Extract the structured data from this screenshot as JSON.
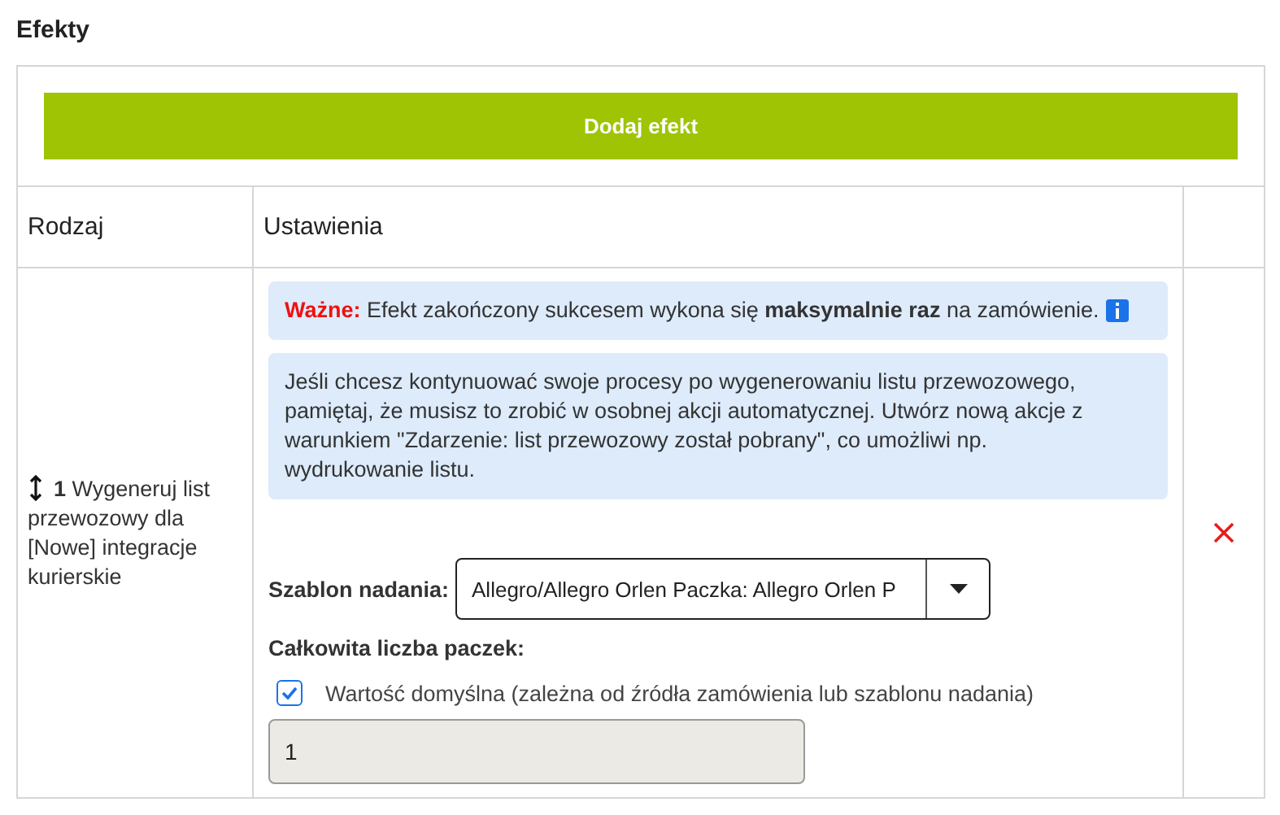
{
  "section_title": "Efekty",
  "add_button": "Dodaj efekt",
  "table": {
    "columns": [
      "Rodzaj",
      "Ustawienia"
    ],
    "rows": [
      {
        "number": "1",
        "name": "Wygeneruj list przewozowy dla [Nowe] integracje kurierskie",
        "notice": {
          "label": "Ważne:",
          "text": "Efekt zakończony sukcesem wykona się **maksymalnie raz** na zamówienie."
        },
        "info": "Jeśli chcesz kontynuować swoje procesy po wygenerowaniu listu przewozowego, pamiętaj, że musisz to zrobić w osobnej akcji automatycznej. Utwórz nową akcje z warunkiem \"Zdarzenie: list przewozowy został pobrany\", co umożliwi np. wydrukowanie listu.",
        "template": {
          "label": "Szablon nadania:",
          "value": "Allegro/Allegro Orlen Paczka: Allegro Orlen P"
        },
        "packages": {
          "label": "Całkowita liczba paczek:",
          "default_checkbox": {
            "label": "Wartość domyślna (zależna od źródła zamówienia lub szablonu nadania)",
            "checked": true
          },
          "value": "1",
          "disabled": true
        }
      }
    ]
  }
}
